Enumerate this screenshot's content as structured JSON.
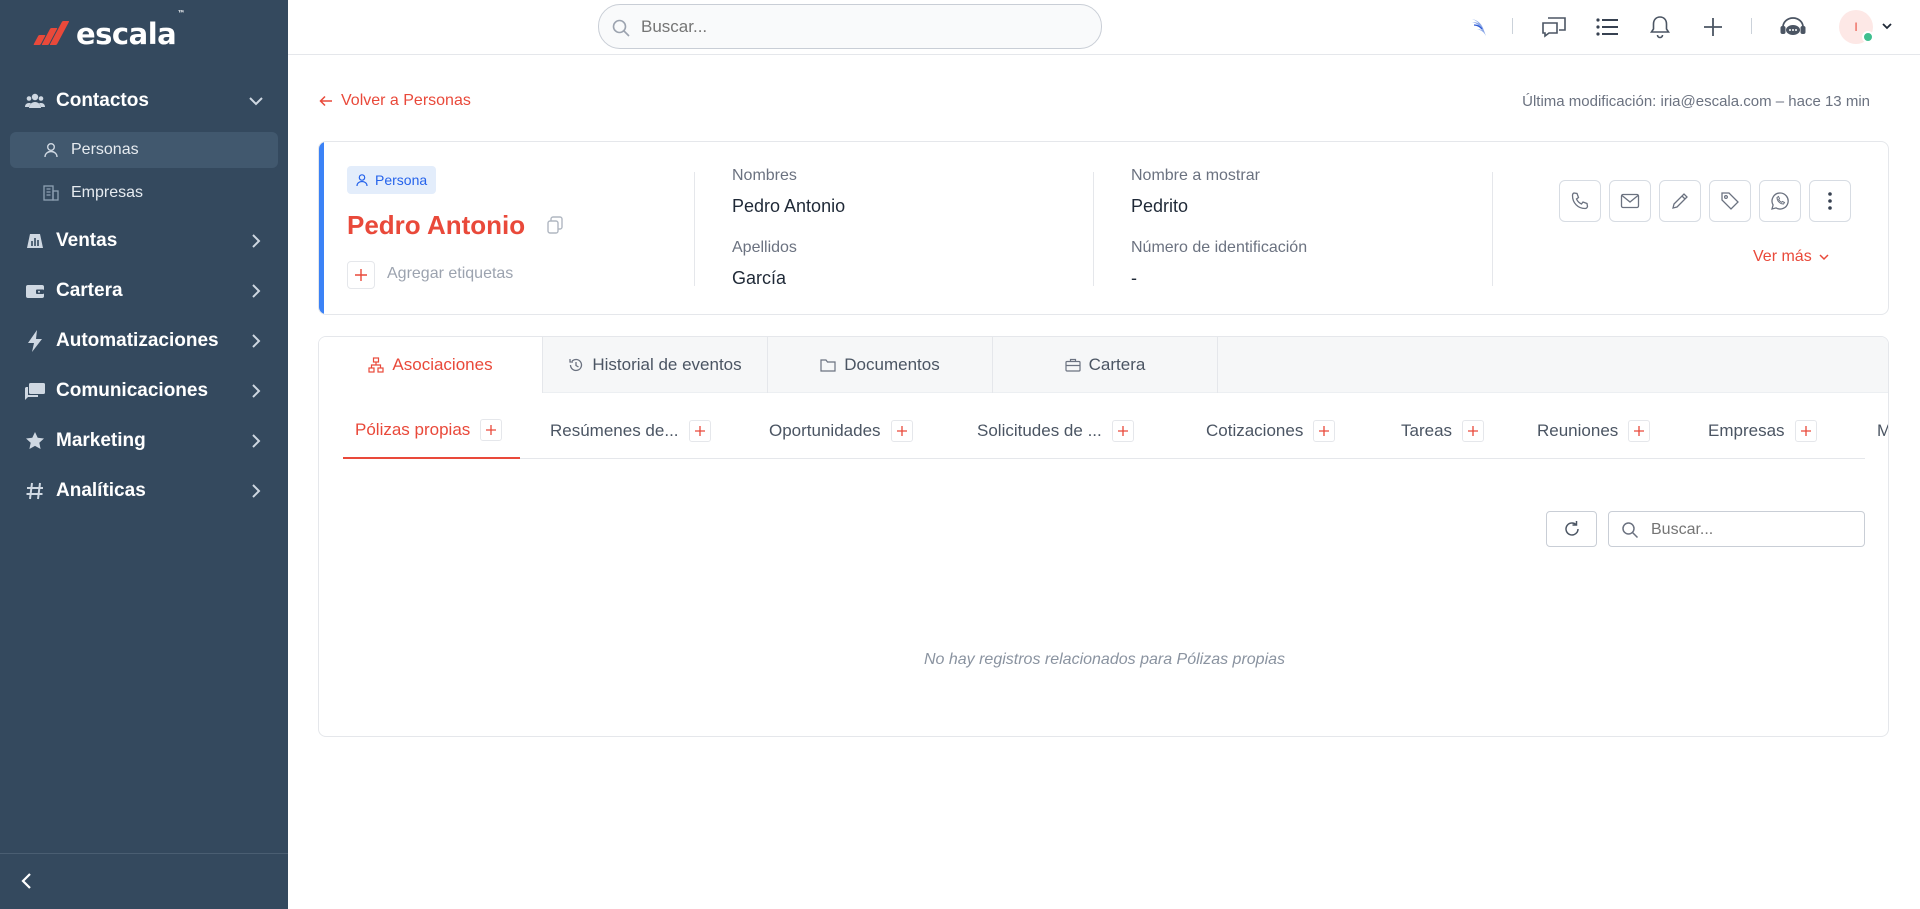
{
  "brand": {
    "name": "escala",
    "tm": "™",
    "accent": "#e9493a"
  },
  "sidebar": {
    "sections": [
      {
        "label": "Contactos",
        "icon": "users-icon",
        "expanded": true
      },
      {
        "label": "Ventas",
        "icon": "bar-chart-icon",
        "expanded": false
      },
      {
        "label": "Cartera",
        "icon": "wallet-icon",
        "expanded": false
      },
      {
        "label": "Automatizaciones",
        "icon": "bolt-icon",
        "expanded": false
      },
      {
        "label": "Comunicaciones",
        "icon": "messages-icon",
        "expanded": false
      },
      {
        "label": "Marketing",
        "icon": "star-icon",
        "expanded": false
      },
      {
        "label": "Analíticas",
        "icon": "hash-icon",
        "expanded": false
      }
    ],
    "contactos_items": [
      {
        "label": "Personas",
        "icon": "person-icon",
        "active": true
      },
      {
        "label": "Empresas",
        "icon": "building-icon",
        "active": false
      }
    ]
  },
  "topbar": {
    "search_placeholder": "Buscar...",
    "avatar_initial": "I"
  },
  "record": {
    "back_label": "Volver a Personas",
    "last_modified": "Última modificación: iria@escala.com – hace 13 min",
    "type_badge": "Persona",
    "name": "Pedro Antonio",
    "add_tags_label": "Agregar etiquetas",
    "fields": {
      "nombres_label": "Nombres",
      "nombres_value": "Pedro Antonio",
      "apellidos_label": "Apellidos",
      "apellidos_value": "García",
      "display_label": "Nombre a mostrar",
      "display_value": "Pedrito",
      "id_label": "Número de identificación",
      "id_value": "-"
    },
    "ver_mas": "Ver más"
  },
  "tabs": {
    "main": [
      {
        "label": "Asociaciones",
        "icon": "sitemap-icon",
        "active": true
      },
      {
        "label": "Historial de eventos",
        "icon": "history-icon",
        "active": false
      },
      {
        "label": "Documentos",
        "icon": "folder-icon",
        "active": false
      },
      {
        "label": "Cartera",
        "icon": "briefcase-icon",
        "active": false
      }
    ],
    "sub": [
      {
        "label": "Pólizas propias",
        "active": true
      },
      {
        "label": "Resúmenes de...",
        "active": false
      },
      {
        "label": "Oportunidades",
        "active": false
      },
      {
        "label": "Solicitudes de ...",
        "active": false
      },
      {
        "label": "Cotizaciones",
        "active": false
      },
      {
        "label": "Tareas",
        "active": false
      },
      {
        "label": "Reuniones",
        "active": false
      },
      {
        "label": "Empresas",
        "active": false
      },
      {
        "label": "M",
        "active": false
      }
    ]
  },
  "table": {
    "search_placeholder": "Buscar...",
    "empty_message": "No hay registros relacionados para Pólizas propias"
  }
}
